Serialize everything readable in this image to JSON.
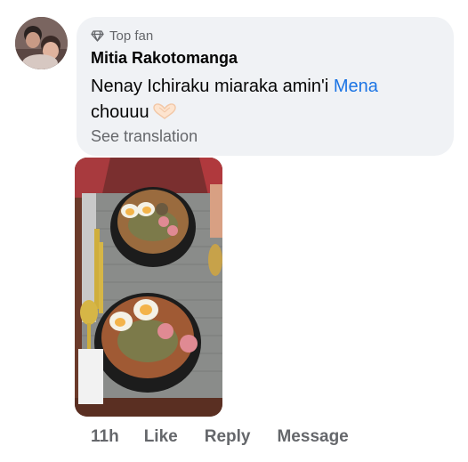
{
  "comment": {
    "badge_label": "Top fan",
    "badge_icon": "diamond-icon",
    "author": "Mitia Rakotomanga",
    "text_before_mention": "Nenay Ichiraku miaraka amin'i ",
    "mention": "Mena",
    "text_after_mention": "chouuu",
    "emoji_icon": "heart-hands-icon",
    "see_translation": "See translation"
  },
  "actions": {
    "time": "11h",
    "like": "Like",
    "reply": "Reply",
    "message": "Message"
  },
  "colors": {
    "bubble_bg": "#f0f2f5",
    "secondary_text": "#65676b",
    "link": "#1b74e4"
  }
}
